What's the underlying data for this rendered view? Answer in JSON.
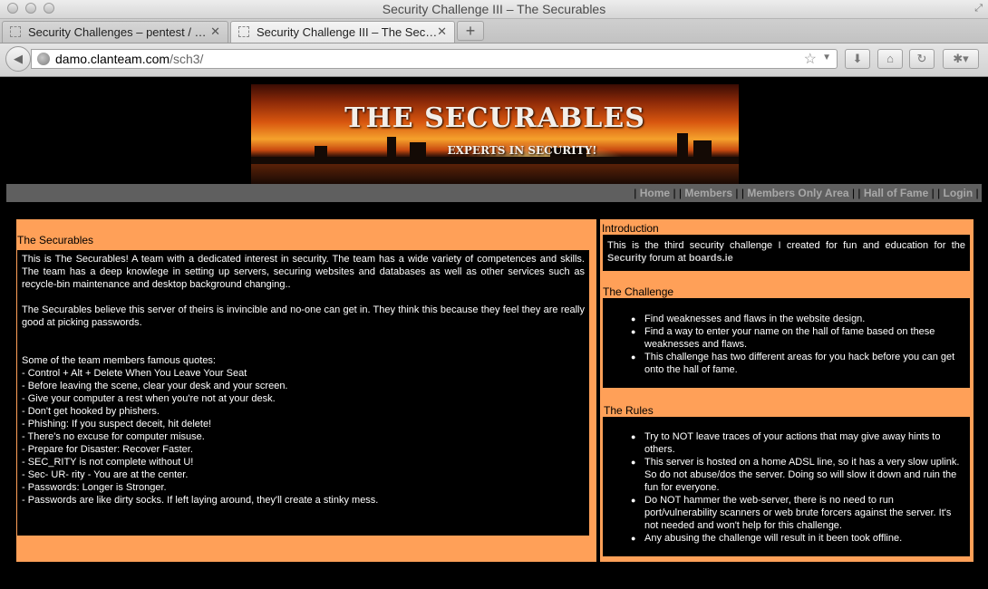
{
  "window": {
    "title": "Security Challenge III – The Securables"
  },
  "tabs": [
    {
      "label": "Security Challenges – pentest / …"
    },
    {
      "label": "Security Challenge III – The Sec…"
    }
  ],
  "address_bar": {
    "url_host": "damo.clanteam.com",
    "url_path": "/sch3/"
  },
  "banner": {
    "title": "THE SECURABLES",
    "subtitle": "EXPERTS IN SECURITY!"
  },
  "nav": {
    "items": [
      "Home",
      "Members",
      "Members Only Area",
      "Hall of Fame",
      "Login"
    ]
  },
  "securables": {
    "title": "The Securables",
    "para1": "This is The Securables! A team with a dedicated interest in security. The team has a wide variety of competences and skills. The team has a deep knowlege in setting up servers, securing websites and databases as well as other services such as recycle-bin maintenance and desktop background changing..",
    "para2": "The Securables believe this server of theirs is invincible and no-one can get in. They think this because they feel they are really good at picking passwords.",
    "quotes_intro": "Some of the team members famous quotes:",
    "quotes": [
      "- Control + Alt + Delete When You Leave Your Seat",
      "- Before leaving the scene, clear your desk and your screen.",
      "- Give your computer a rest when you're not at your desk.",
      "- Don't get hooked by phishers.",
      "- Phishing: If you suspect deceit, hit delete!",
      "- There's no excuse for computer misuse.",
      "- Prepare for Disaster: Recover Faster.",
      "- SEC_RITY is not complete without U!",
      "- Sec- UR- rity - You are at the center.",
      "- Passwords: Longer is Stronger.",
      "- Passwords are like dirty socks. If left laying around, they'll create a stinky mess."
    ]
  },
  "introduction": {
    "title": "Introduction",
    "text_before": "This is the third security challenge I created for fun and education for the ",
    "link1": "Security",
    "text_middle": " forum at ",
    "link2": "boards.ie"
  },
  "challenge": {
    "title": "The Challenge",
    "items": [
      "Find weaknesses and flaws in the website design.",
      "Find a way to enter your name on the hall of fame based on these weaknesses and flaws.",
      "This challenge has two different areas for you hack before you can get onto the hall of fame."
    ]
  },
  "rules": {
    "title": "The Rules",
    "items": [
      "Try to NOT leave traces of your actions that may give away hints to others.",
      "This server is hosted on a home ADSL line, so it has a very slow uplink. So do not abuse/dos the server. Doing so will slow it down and ruin the fun for everyone.",
      "Do NOT hammer the web-server, there is no need to run port/vulnerability scanners or web brute forcers against the server. It's not needed and won't help for this challenge.",
      "Any abusing the challenge will result in it been took offline."
    ]
  }
}
